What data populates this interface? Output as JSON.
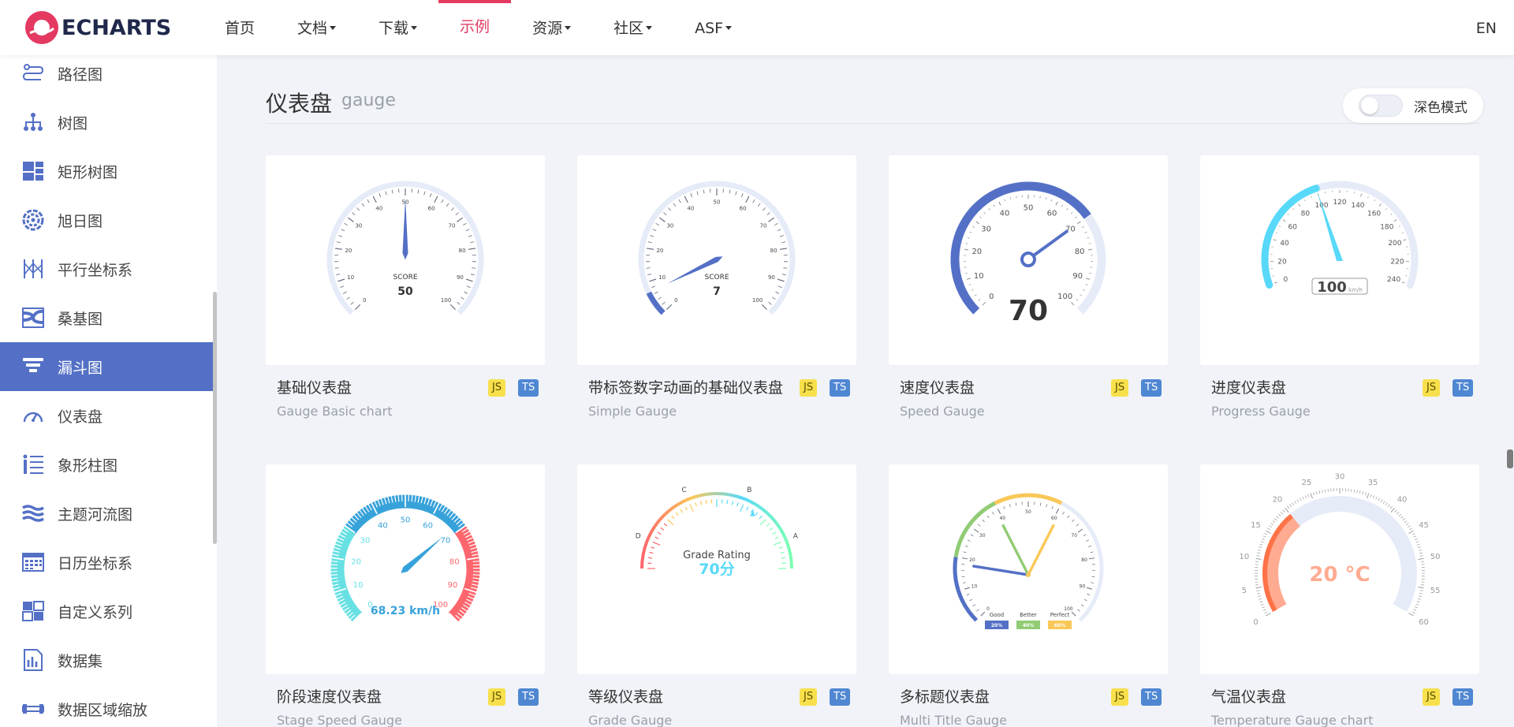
{
  "nav": {
    "logo_text": "ECHARTS",
    "items": [
      {
        "label": "首页",
        "caret": false
      },
      {
        "label": "文档",
        "caret": true
      },
      {
        "label": "下载",
        "caret": true
      },
      {
        "label": "示例",
        "caret": false
      },
      {
        "label": "资源",
        "caret": true
      },
      {
        "label": "社区",
        "caret": true
      },
      {
        "label": "ASF",
        "caret": true
      }
    ],
    "active": "示例",
    "lang": "EN"
  },
  "sidebar": {
    "items": [
      {
        "label": "路径图",
        "icon": "route-icon"
      },
      {
        "label": "树图",
        "icon": "tree-icon"
      },
      {
        "label": "矩形树图",
        "icon": "treemap-icon"
      },
      {
        "label": "旭日图",
        "icon": "sunburst-icon"
      },
      {
        "label": "平行坐标系",
        "icon": "parallel-icon"
      },
      {
        "label": "桑基图",
        "icon": "sankey-icon"
      },
      {
        "label": "漏斗图",
        "icon": "funnel-icon"
      },
      {
        "label": "仪表盘",
        "icon": "gauge-icon"
      },
      {
        "label": "象形柱图",
        "icon": "pictorial-bar-icon"
      },
      {
        "label": "主题河流图",
        "icon": "theme-river-icon"
      },
      {
        "label": "日历坐标系",
        "icon": "calendar-icon"
      },
      {
        "label": "自定义系列",
        "icon": "custom-series-icon"
      },
      {
        "label": "数据集",
        "icon": "dataset-icon"
      },
      {
        "label": "数据区域缩放",
        "icon": "data-zoom-icon"
      }
    ],
    "active": "漏斗图"
  },
  "section": {
    "title": "仪表盘",
    "subtitle": "gauge",
    "dark_mode_label": "深色模式"
  },
  "badges": {
    "js": "JS",
    "ts": "TS"
  },
  "cards": [
    {
      "name": "基础仪表盘",
      "en": "Gauge Basic chart"
    },
    {
      "name": "带标签数字动画的基础仪表盘",
      "en": "Simple Gauge"
    },
    {
      "name": "速度仪表盘",
      "en": "Speed Gauge"
    },
    {
      "name": "进度仪表盘",
      "en": "Progress Gauge"
    },
    {
      "name": "阶段速度仪表盘",
      "en": "Stage Speed Gauge"
    },
    {
      "name": "等级仪表盘",
      "en": "Grade Gauge"
    },
    {
      "name": "多标题仪表盘",
      "en": "Multi Title Gauge"
    },
    {
      "name": "气温仪表盘",
      "en": "Temperature Gauge chart"
    }
  ],
  "gauges": {
    "basic": {
      "label": "SCORE",
      "value": "50",
      "ticks": [
        "0",
        "10",
        "20",
        "30",
        "40",
        "50",
        "60",
        "70",
        "80",
        "90",
        "100"
      ]
    },
    "simple": {
      "label": "SCORE",
      "value": "7",
      "ticks": [
        "0",
        "10",
        "20",
        "30",
        "40",
        "50",
        "60",
        "70",
        "80",
        "90",
        "100"
      ]
    },
    "speed": {
      "value": "70",
      "ticks": [
        "0",
        "10",
        "20",
        "30",
        "40",
        "50",
        "60",
        "70",
        "80",
        "90",
        "100"
      ]
    },
    "progress": {
      "value": "100",
      "unit": "km/h",
      "ticks": [
        "0",
        "20",
        "40",
        "60",
        "80",
        "100",
        "120",
        "140",
        "160",
        "180",
        "200",
        "220",
        "240"
      ]
    },
    "stage": {
      "value": "68.23 km/h",
      "ticks": [
        "0",
        "10",
        "20",
        "30",
        "40",
        "50",
        "60",
        "70",
        "80",
        "90",
        "100"
      ]
    },
    "grade": {
      "title": "Grade Rating",
      "value": "70分",
      "letters": [
        "D",
        "C",
        "B",
        "A"
      ]
    },
    "multi": {
      "ticks": [
        "0",
        "10",
        "20",
        "30",
        "40",
        "50",
        "60",
        "70",
        "80",
        "90",
        "100"
      ],
      "legend": [
        {
          "label": "Good",
          "value": "20%",
          "color": "#5470c6"
        },
        {
          "label": "Better",
          "value": "40%",
          "color": "#91cc75"
        },
        {
          "label": "Perfect",
          "value": "60%",
          "color": "#fac858"
        }
      ]
    },
    "temperature": {
      "value": "20 °C",
      "ticks": [
        "0",
        "5",
        "10",
        "15",
        "20",
        "25",
        "30",
        "35",
        "40",
        "45",
        "50",
        "55",
        "60"
      ]
    }
  },
  "colors": {
    "accent": "#e43961",
    "primary": "#5470c6"
  }
}
